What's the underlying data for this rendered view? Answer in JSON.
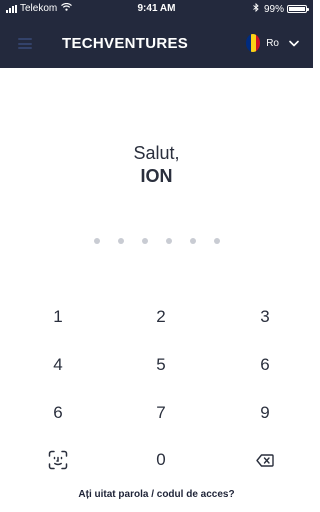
{
  "status_bar": {
    "carrier": "Telekom",
    "time": "9:41 AM",
    "battery": "99%",
    "icons": [
      "signal-icon",
      "wifi-icon",
      "bluetooth-icon",
      "battery-icon"
    ]
  },
  "header": {
    "title": "TECHVENTURES",
    "language": "Ro",
    "menu_icon": "hamburger-menu-icon",
    "flag": "romania-flag-icon",
    "flag_colors": [
      "#002b7f",
      "#fcd116",
      "#ce1126"
    ],
    "background": "#23293d"
  },
  "greeting": {
    "line1": "Salut,",
    "name": "ION"
  },
  "pin": {
    "length": 6,
    "entered": 0,
    "dot_color": "#c9ccd3"
  },
  "keypad": {
    "keys": [
      [
        "1",
        "2",
        "3"
      ],
      [
        "4",
        "5",
        "6"
      ],
      [
        "6",
        "7",
        "9"
      ],
      [
        "face-id-icon",
        "0",
        "backspace-icon"
      ]
    ],
    "k1": "1",
    "k2": "2",
    "k3": "3",
    "k4": "4",
    "k5": "5",
    "k6": "6",
    "k7": "6",
    "k8": "7",
    "k9": "9",
    "k0": "0"
  },
  "forgot_link": "Ați uitat parola / codul de acces?"
}
